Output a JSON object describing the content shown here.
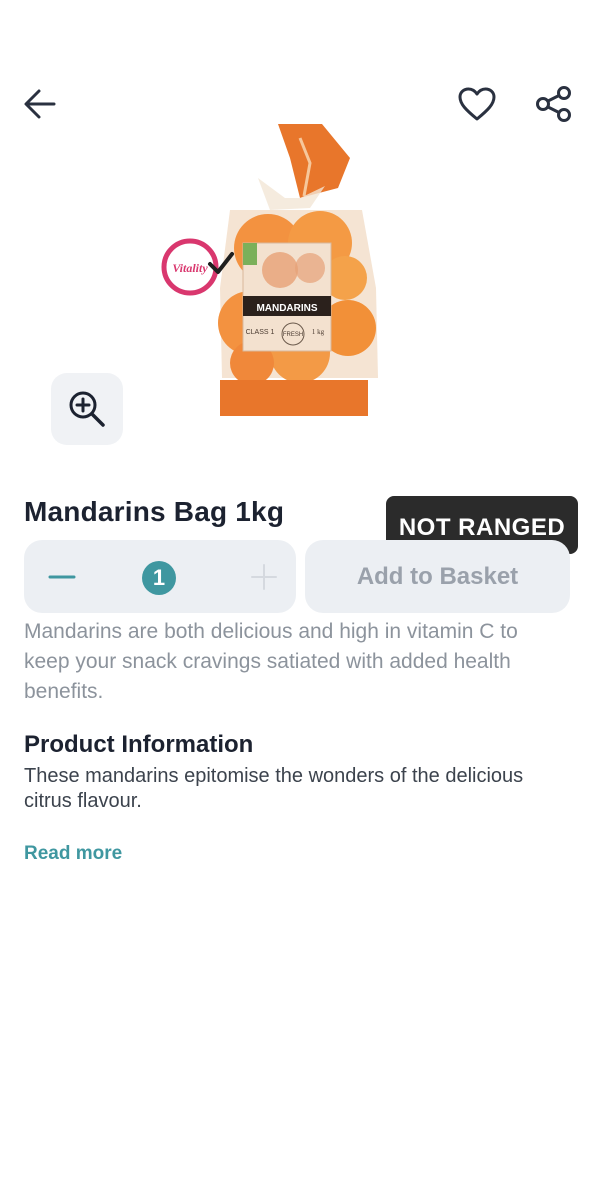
{
  "header": {
    "back_icon": "arrow-left-icon",
    "favorite_icon": "heart-icon",
    "share_icon": "share-icon"
  },
  "product": {
    "image_label": "Mandarins bag image",
    "bag_label": "MANDARINS",
    "bag_class": "CLASS 1",
    "bag_fresh": "FRESH",
    "bag_weight": "1 kg",
    "vitality_logo": "Vitality",
    "name": "Mandarins Bag 1kg",
    "badge": "NOT RANGED",
    "quantity": "1",
    "add_label": "Add to Basket",
    "description": "Mandarins are both delicious and high in vitamin C to keep your snack cravings satiated with added health benefits."
  },
  "info": {
    "title": "Product Information",
    "text": "These mandarins epitomise the wonders of the delicious citrus flavour.",
    "read_more": "Read more"
  },
  "colors": {
    "accent": "#3f97a0",
    "badge_bg": "#2b2b2b",
    "control_bg": "#eceff3",
    "vitality_pink": "#d9376e",
    "bag_orange": "#e8762b"
  }
}
